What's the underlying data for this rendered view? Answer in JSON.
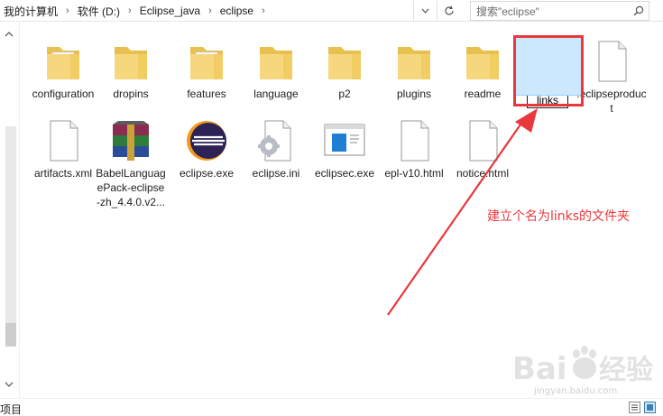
{
  "address_bar": {
    "crumbs": [
      "我的计算机",
      "软件 (D:)",
      "Eclipse_java",
      "eclipse"
    ],
    "search_placeholder": "搜索\"eclipse\""
  },
  "items": [
    {
      "label": "configuration",
      "type": "folder"
    },
    {
      "label": "dropins",
      "type": "folder"
    },
    {
      "label": "features",
      "type": "folder"
    },
    {
      "label": "language",
      "type": "folder"
    },
    {
      "label": "p2",
      "type": "folder"
    },
    {
      "label": "plugins",
      "type": "folder"
    },
    {
      "label": "readme",
      "type": "folder"
    },
    {
      "label": "links",
      "type": "folder",
      "state": "renaming"
    },
    {
      "label": ".eclipseproduct",
      "type": "file"
    },
    {
      "label": "artifacts.xml",
      "type": "file"
    },
    {
      "label": "BabelLanguagePack-eclipse-zh_4.4.0.v2...",
      "type": "archive"
    },
    {
      "label": "eclipse.exe",
      "type": "eclipse-exe"
    },
    {
      "label": "eclipse.ini",
      "type": "ini"
    },
    {
      "label": "eclipsec.exe",
      "type": "window-exe"
    },
    {
      "label": "epl-v10.html",
      "type": "file"
    },
    {
      "label": "notice.html",
      "type": "file"
    }
  ],
  "annotation": {
    "text": "建立个名为links的文件夹",
    "color": "#e8383d"
  },
  "status_bar": {
    "text": "项目"
  },
  "watermark": {
    "text": "jingyan.baidu.com"
  },
  "colors": {
    "folder": "#f6d77e",
    "folder_dark": "#e8c04f",
    "selection": "#cce8ff",
    "accent_red": "#e8383d"
  }
}
